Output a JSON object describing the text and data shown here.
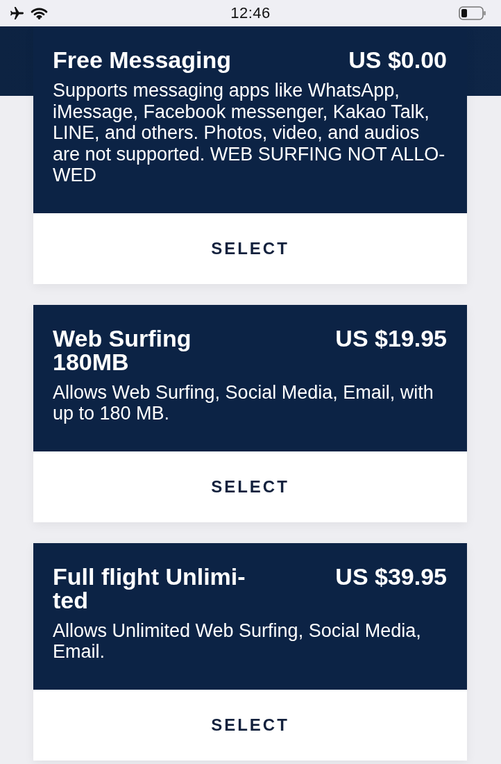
{
  "status_bar": {
    "time": "12:46"
  },
  "plans": [
    {
      "title": "Free Messaging",
      "price": "US $0.00",
      "description": "Supports messaging apps like WhatsApp, iMessage, Facebook messenger, Kakao Talk, LINE, and others. Photos, video, and audios are not supported. WEB SURFING NOT ALLO-WED",
      "button": "SELECT"
    },
    {
      "title": "Web Surfing 180MB",
      "price": "US $19.95",
      "description": "Allows Web Surfing, Social Media, Email, with up to 180 MB.",
      "button": "SELECT"
    },
    {
      "title": "Full flight Unlimi-ted",
      "price": "US $39.95",
      "description": "Allows Unlimited Web Surfing, Social Media, Email.",
      "button": "SELECT"
    }
  ]
}
